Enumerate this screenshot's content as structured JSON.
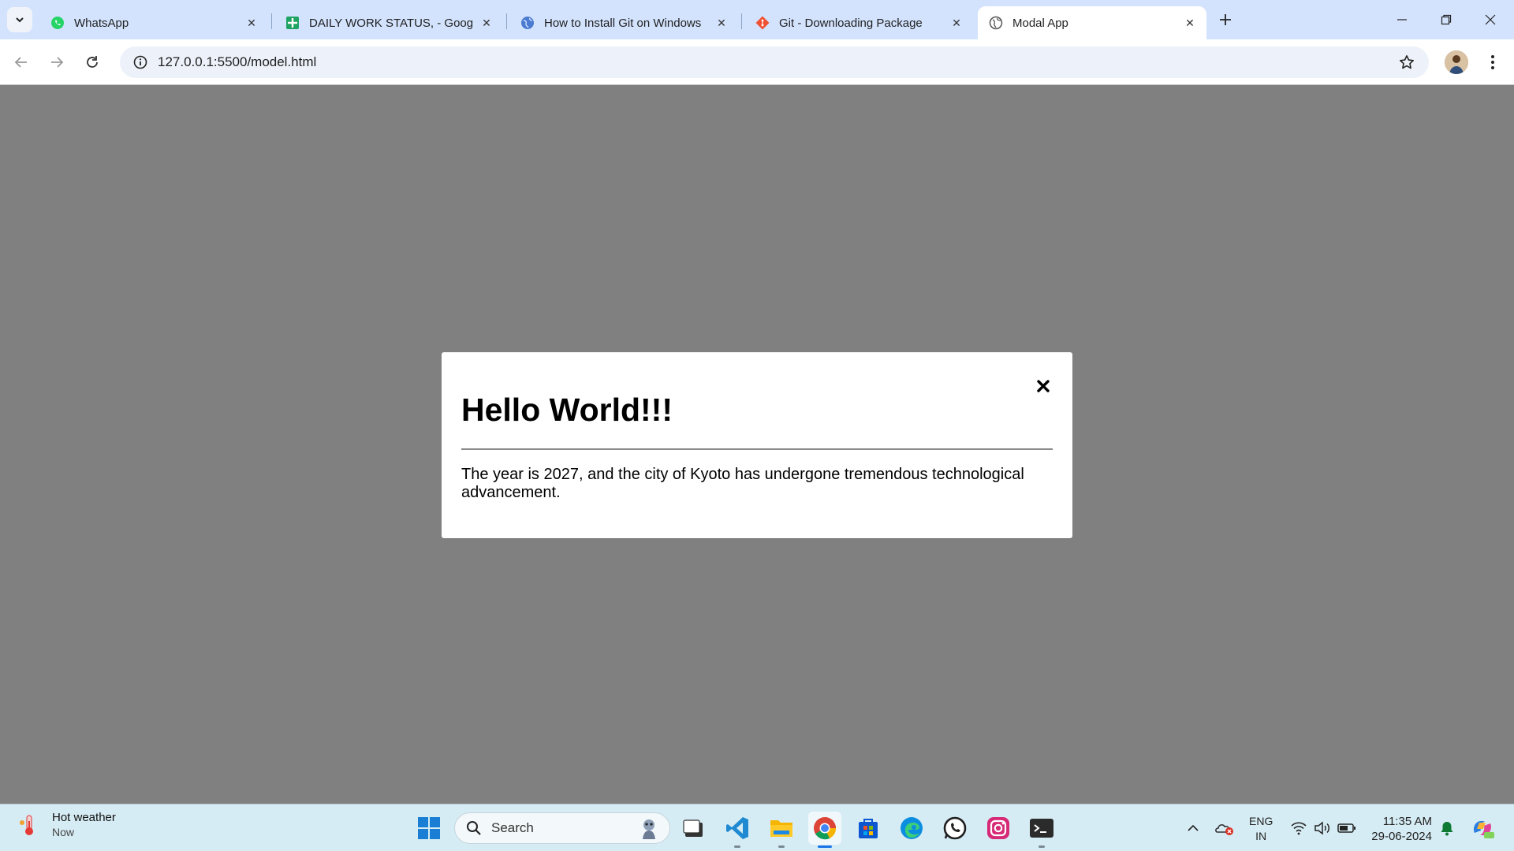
{
  "browser": {
    "tabs": [
      {
        "title": "WhatsApp",
        "icon": "whatsapp-icon"
      },
      {
        "title": "DAILY WORK STATUS, - Google",
        "icon": "sheets-icon"
      },
      {
        "title": "How to Install Git on Windows",
        "icon": "globe-icon"
      },
      {
        "title": "Git - Downloading Package",
        "icon": "git-icon"
      },
      {
        "title": "Modal App",
        "icon": "globe-icon",
        "active": true
      }
    ],
    "url": "127.0.0.1:5500/model.html"
  },
  "modal": {
    "title": "Hello World!!!",
    "body": "The year is 2027, and the city of Kyoto has undergone tremendous technological advancement."
  },
  "taskbar": {
    "weather": {
      "title": "Hot weather",
      "subtitle": "Now"
    },
    "search_placeholder": "Search",
    "language": {
      "line1": "ENG",
      "line2": "IN"
    },
    "clock": {
      "time": "11:35 AM",
      "date": "29-06-2024"
    }
  },
  "colors": {
    "tabstrip": "#d3e3fd",
    "page_overlay": "#808080",
    "taskbar": "#d6ecf4"
  }
}
